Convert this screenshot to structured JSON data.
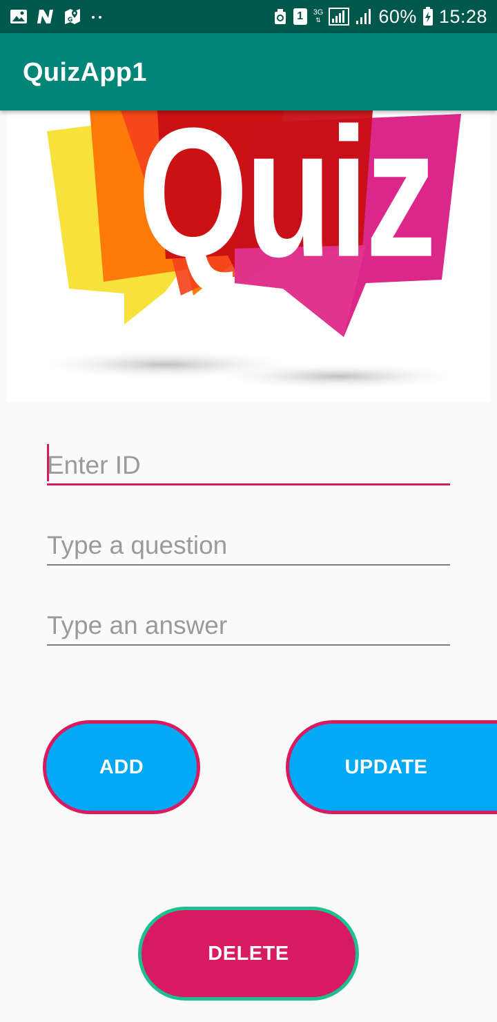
{
  "status_bar": {
    "time": "15:28",
    "battery": "60%",
    "network": "3G",
    "sim_slot": "1",
    "icons": [
      "gallery-icon",
      "n-icon",
      "maps-icon",
      "dots-icon",
      "recycle-icon",
      "sim-icon",
      "network-3g-icon",
      "signal-icon",
      "signal-icon",
      "battery-icon"
    ]
  },
  "app_bar": {
    "title": "QuizApp1",
    "color": "#008577"
  },
  "banner": {
    "text": "Quiz"
  },
  "form": {
    "id_placeholder": "Enter ID",
    "question_placeholder": "Type a question",
    "answer_placeholder": "Type an answer",
    "accent": "#d81b60"
  },
  "buttons": {
    "add": "ADD",
    "update": "UPDATE",
    "delete": "DELETE",
    "blue": "#03a9f4",
    "pink": "#d81b60",
    "green_border": "#1fbf8f"
  }
}
